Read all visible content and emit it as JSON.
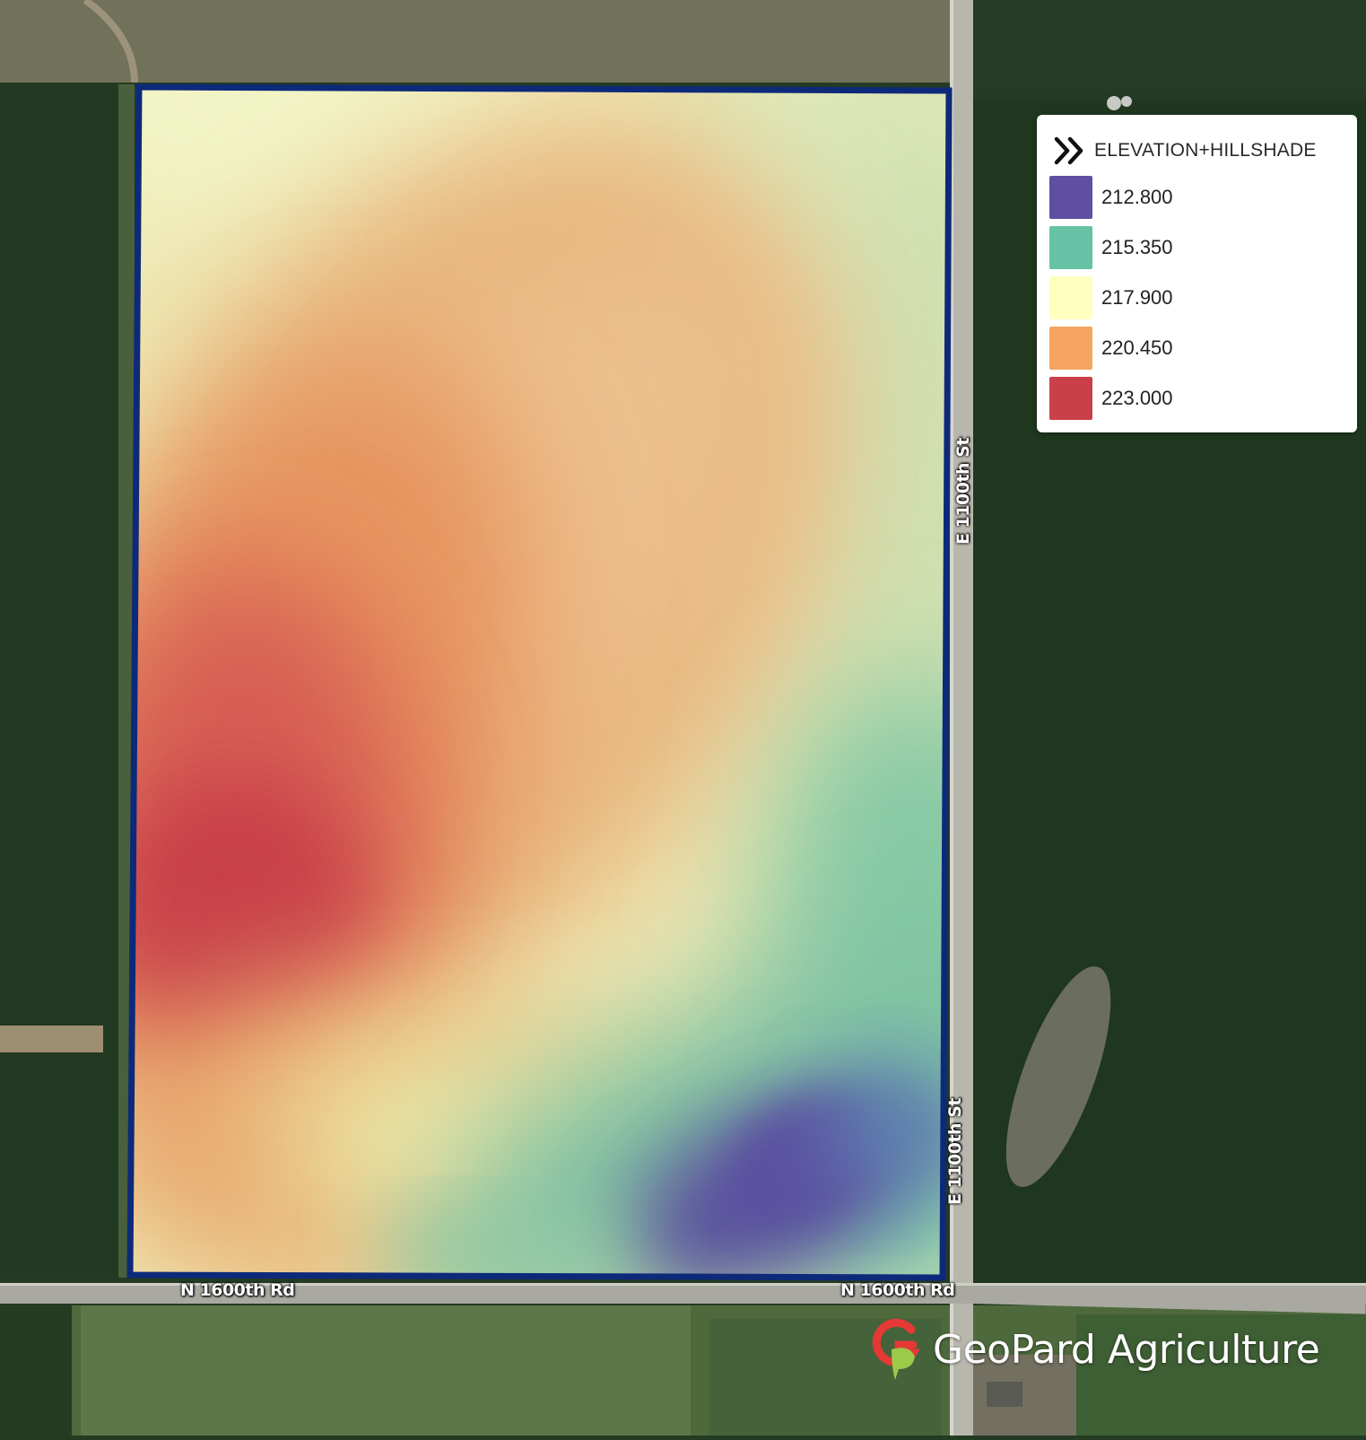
{
  "map": {
    "field_boundary_color": "#0d2a7a",
    "roads": {
      "e1100_upper": "E 1100th St",
      "e1100_lower": "E 1100th St",
      "n1600_left": "N 1600th Rd",
      "n1600_right": "N 1600th Rd"
    }
  },
  "legend": {
    "title": "ELEVATION+HILLSHADE",
    "toggle_icon": "double-chevron-right-icon",
    "items": [
      {
        "label": "212.800",
        "color": "#5e4fa2"
      },
      {
        "label": "215.350",
        "color": "#66c2a5"
      },
      {
        "label": "217.900",
        "color": "#ffffbf"
      },
      {
        "label": "220.450",
        "color": "#f4a460"
      },
      {
        "label": "223.000",
        "color": "#c9404a"
      }
    ]
  },
  "brand": {
    "name": "GeoPard Agriculture",
    "logo_icon": "geopard-logo-icon",
    "colors": {
      "red": "#e53935",
      "green": "#9bc94a"
    }
  }
}
